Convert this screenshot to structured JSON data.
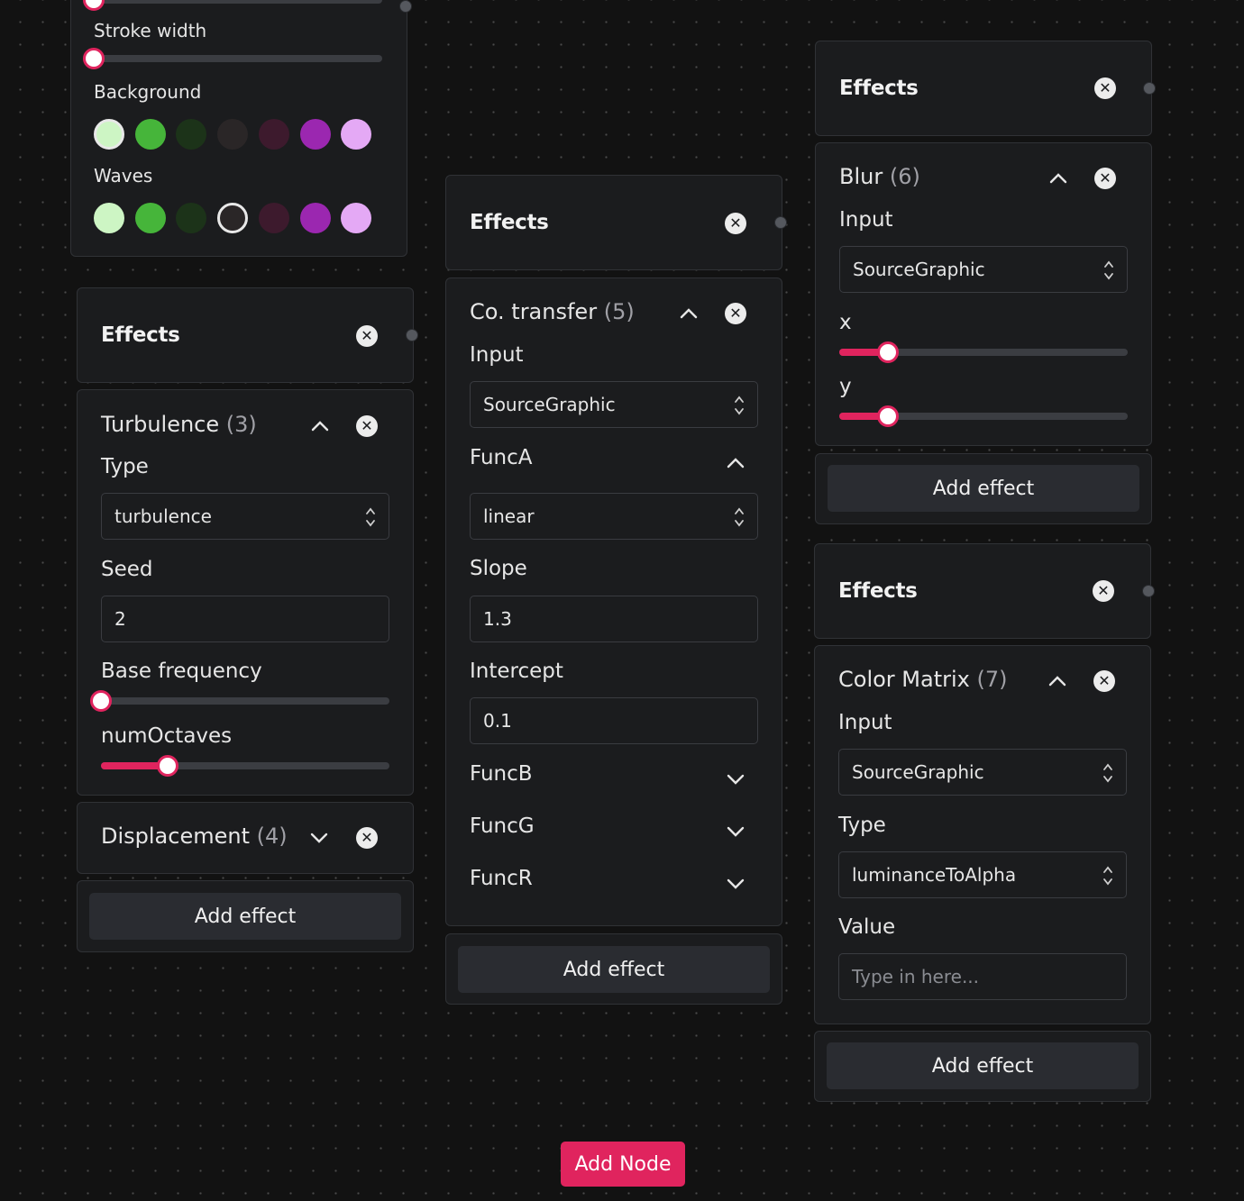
{
  "top_panel": {
    "stroke_width_label": "Stroke width",
    "stroke_width_level": 0,
    "background_label": "Background",
    "waves_label": "Waves",
    "background_swatches": [
      "#cdf5c4",
      "#46b53a",
      "#1c3319",
      "#2a2627",
      "#3d1a2d",
      "#9b27b0",
      "#e4a9f5"
    ],
    "background_selected": 0,
    "waves_swatches": [
      "#cdf5c4",
      "#46b53a",
      "#1c3319",
      "#2a2627",
      "#3d1a2d",
      "#9b27b0",
      "#e4a9f5"
    ],
    "waves_selected": 3
  },
  "col1": {
    "header": "Effects",
    "turbulence": {
      "title": "Turbulence",
      "count": "(3)",
      "type_label": "Type",
      "type_value": "turbulence",
      "seed_label": "Seed",
      "seed_value": "2",
      "base_frequency_label": "Base frequency",
      "base_frequency_level": 0,
      "num_octaves_label": "numOctaves",
      "num_octaves_level": 0.23
    },
    "displacement": {
      "title": "Displacement",
      "count": "(4)"
    },
    "add_effect": "Add effect"
  },
  "col2": {
    "header": "Effects",
    "co_transfer": {
      "title": "Co. transfer",
      "count": "(5)",
      "input_label": "Input",
      "input_value": "SourceGraphic",
      "funca_label": "FuncA",
      "funca_type": "linear",
      "slope_label": "Slope",
      "slope_value": "1.3",
      "intercept_label": "Intercept",
      "intercept_value": "0.1",
      "funcb_label": "FuncB",
      "funcg_label": "FuncG",
      "funcr_label": "FuncR"
    },
    "add_effect": "Add effect"
  },
  "col3a": {
    "header": "Effects",
    "blur": {
      "title": "Blur",
      "count": "(6)",
      "input_label": "Input",
      "input_value": "SourceGraphic",
      "x_label": "x",
      "x_level": 0.17,
      "y_label": "y",
      "y_level": 0.17
    },
    "add_effect": "Add effect"
  },
  "col3b": {
    "header": "Effects",
    "color_matrix": {
      "title": "Color Matrix",
      "count": "(7)",
      "input_label": "Input",
      "input_value": "SourceGraphic",
      "type_label": "Type",
      "type_value": "luminanceToAlpha",
      "value_label": "Value",
      "value_placeholder": "Type in here..."
    },
    "add_effect": "Add effect"
  },
  "add_node": "Add Node",
  "colors": {
    "accent": "#e0245e",
    "panel": "#1b1c1e",
    "border": "#303236"
  }
}
